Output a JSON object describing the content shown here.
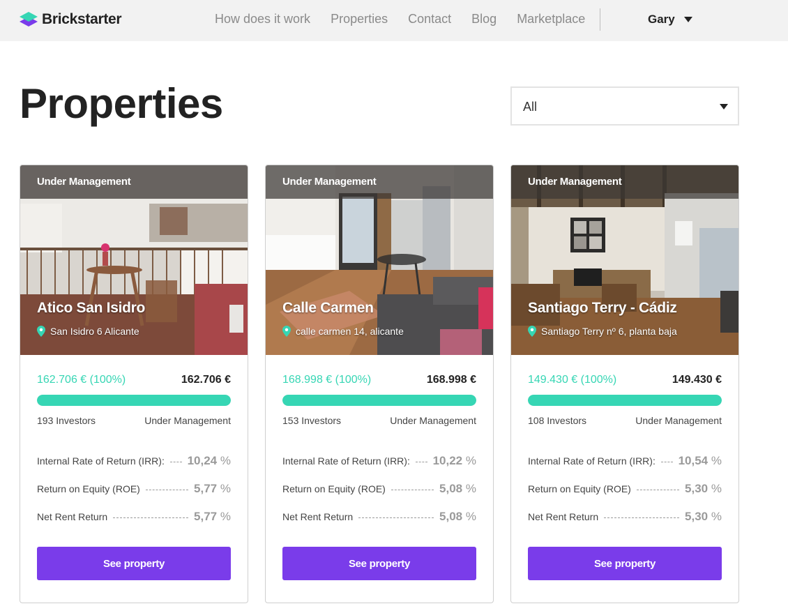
{
  "header": {
    "brand": "Brickstarter",
    "nav": [
      {
        "label": "How does it work"
      },
      {
        "label": "Properties"
      },
      {
        "label": "Contact"
      },
      {
        "label": "Blog"
      },
      {
        "label": "Marketplace"
      }
    ],
    "user": "Gary"
  },
  "page": {
    "title": "Properties",
    "filter": {
      "selected": "All"
    }
  },
  "colors": {
    "accent_teal": "#36d6b4",
    "button_purple": "#7a3cea"
  },
  "cards": [
    {
      "status": "Under Management",
      "name": "Atico San Isidro",
      "address": "San Isidro 6 Alicante",
      "funded": "162.706 € (100%)",
      "goal": "162.706 €",
      "progress_percent": 100,
      "investors": "193 Investors",
      "state": "Under Management",
      "metrics": [
        {
          "label": "Internal Rate of Return (IRR):",
          "value": "10,24",
          "unit": "%"
        },
        {
          "label": "Return on Equity (ROE)",
          "value": "5,77",
          "unit": "%"
        },
        {
          "label": "Net Rent Return",
          "value": "5,77",
          "unit": "%"
        }
      ],
      "button": "See property"
    },
    {
      "status": "Under Management",
      "name": "Calle Carmen",
      "address": "calle carmen 14, alicante",
      "funded": "168.998 € (100%)",
      "goal": "168.998 €",
      "progress_percent": 100,
      "investors": "153 Investors",
      "state": "Under Management",
      "metrics": [
        {
          "label": "Internal Rate of Return (IRR):",
          "value": "10,22",
          "unit": "%"
        },
        {
          "label": "Return on Equity (ROE)",
          "value": "5,08",
          "unit": "%"
        },
        {
          "label": "Net Rent Return",
          "value": "5,08",
          "unit": "%"
        }
      ],
      "button": "See property"
    },
    {
      "status": "Under Management",
      "name": "Santiago Terry - Cádiz",
      "address": "Santiago Terry nº 6, planta baja",
      "funded": "149.430 € (100%)",
      "goal": "149.430 €",
      "progress_percent": 100,
      "investors": "108 Investors",
      "state": "Under Management",
      "metrics": [
        {
          "label": "Internal Rate of Return (IRR):",
          "value": "10,54",
          "unit": "%"
        },
        {
          "label": "Return on Equity (ROE)",
          "value": "5,30",
          "unit": "%"
        },
        {
          "label": "Net Rent Return",
          "value": "5,30",
          "unit": "%"
        }
      ],
      "button": "See property"
    }
  ]
}
